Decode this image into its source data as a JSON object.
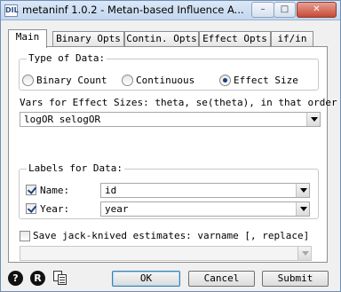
{
  "window": {
    "title": "metaninf 1.0.2 - Metan-based Influence A...",
    "app_icon_text": "DIL",
    "controls": {
      "minimize": "–",
      "maximize": "□",
      "close": "✕"
    }
  },
  "tabs": [
    {
      "label": "Main",
      "active": true
    },
    {
      "label": "Binary Opts",
      "active": false
    },
    {
      "label": "Contin. Opts",
      "active": false
    },
    {
      "label": "Effect Opts",
      "active": false
    },
    {
      "label": "if/in",
      "active": false
    }
  ],
  "type_of_data": {
    "legend": "Type of Data:",
    "options": [
      {
        "label": "Binary Count",
        "selected": false
      },
      {
        "label": "Continuous",
        "selected": false
      },
      {
        "label": "Effect Size",
        "selected": true
      }
    ]
  },
  "vars": {
    "label": "Vars for Effect Sizes: theta, se(theta), in that order",
    "value": "logOR selogOR"
  },
  "labels": {
    "legend": "Labels for Data:",
    "name": {
      "label": "Name:",
      "checked": true,
      "value": "id"
    },
    "year": {
      "label": "Year:",
      "checked": true,
      "value": "year"
    }
  },
  "save": {
    "label": "Save jack-knived estimates: varname [, replace]",
    "checked": false,
    "value": ""
  },
  "bottom": {
    "help_icon": "?",
    "reset_icon": "R",
    "copy_icon": "copy-icon",
    "ok": "OK",
    "cancel": "Cancel",
    "submit": "Submit"
  }
}
